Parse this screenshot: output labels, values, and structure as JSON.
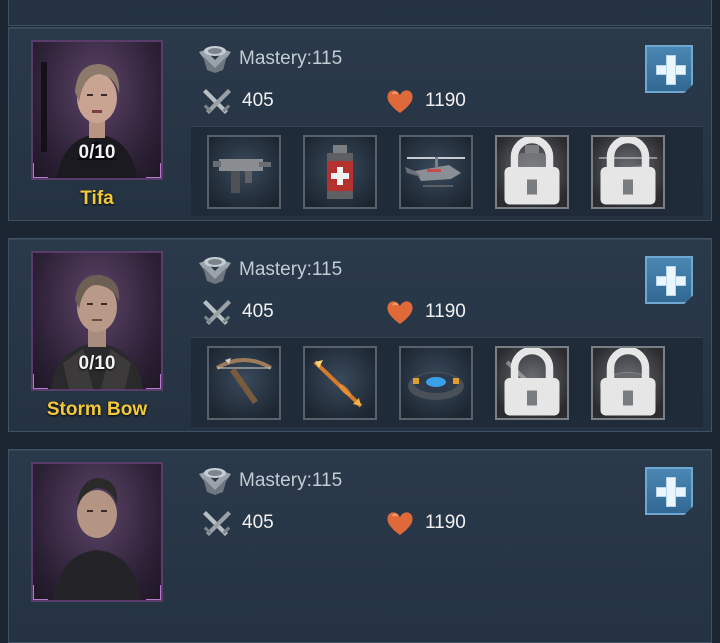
{
  "colors": {
    "hero_name": "#f3c83a",
    "add_button": "#3f7aa6",
    "health_icon": "#e0693a"
  },
  "heroes": [
    {
      "name": "Tifa",
      "level": "0/10",
      "mastery": "Mastery:115",
      "attack": "405",
      "health": "1190",
      "gear": [
        {
          "icon": "submachine-gun-icon",
          "locked": false
        },
        {
          "icon": "medkit-grenade-icon",
          "locked": false
        },
        {
          "icon": "helicopter-icon",
          "locked": false
        },
        {
          "icon": "grenade-icon",
          "locked": true
        },
        {
          "icon": "helicopter-icon",
          "locked": true
        }
      ]
    },
    {
      "name": "Storm Bow",
      "level": "0/10",
      "mastery": "Mastery:115",
      "attack": "405",
      "health": "1190",
      "gear": [
        {
          "icon": "crossbow-icon",
          "locked": false
        },
        {
          "icon": "fire-arrow-icon",
          "locked": false
        },
        {
          "icon": "disc-device-icon",
          "locked": false
        },
        {
          "icon": "arrow-icon",
          "locked": true
        },
        {
          "icon": "disc-device-icon",
          "locked": true
        }
      ]
    },
    {
      "mastery": "Mastery:115",
      "attack": "405",
      "health": "1190"
    }
  ]
}
